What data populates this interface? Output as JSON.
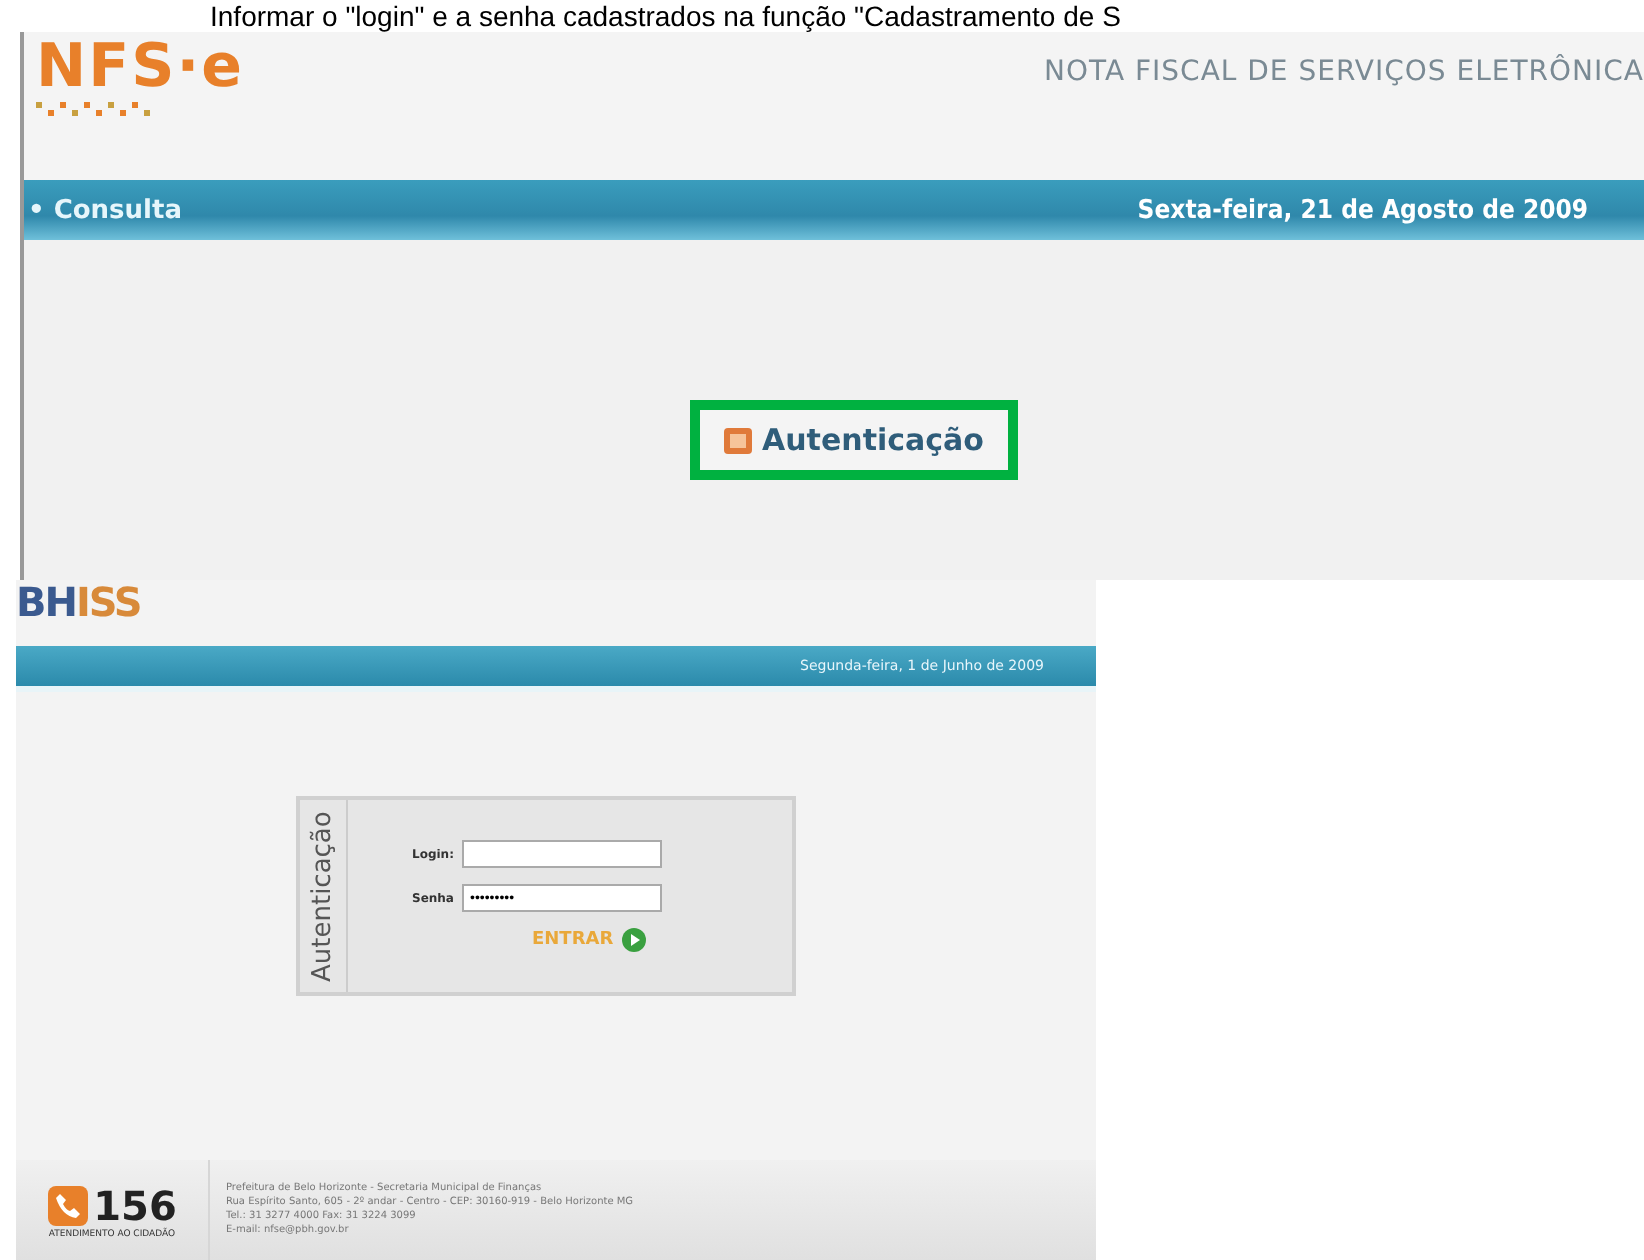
{
  "caption": "Informar o \"login\" e a senha cadastrados na função \"Cadastramento de S",
  "nfse": {
    "logo": "NFS·e",
    "title": "NOTA FISCAL DE SERVIÇOS ELETRÔNICA",
    "menu_item": "• Consulta",
    "date": "Sexta-feira, 21 de Agosto de 2009",
    "auth_link": "Autenticação"
  },
  "bhiss": {
    "logo_a": "BH",
    "logo_b": "ISS",
    "date": "Segunda-feira, 1 de Junho de 2009",
    "auth_title": "Autenticação",
    "fields": [
      {
        "label": "Login:"
      },
      {
        "label": "Senha",
        "value": "•••••••••"
      }
    ],
    "submit": "ENTRAR",
    "footer": {
      "phone": "156",
      "service": "ATENDIMENTO AO CIDADÃO",
      "lines": [
        "Prefeitura de Belo Horizonte - Secretaria Municipal de Finanças",
        "Rua Espírito Santo, 605 - 2º andar - Centro - CEP: 30160-919 - Belo Horizonte MG",
        "Tel.: 31 3277 4000 Fax: 31 3224 3099",
        "E-mail: nfse@pbh.gov.br"
      ]
    }
  }
}
